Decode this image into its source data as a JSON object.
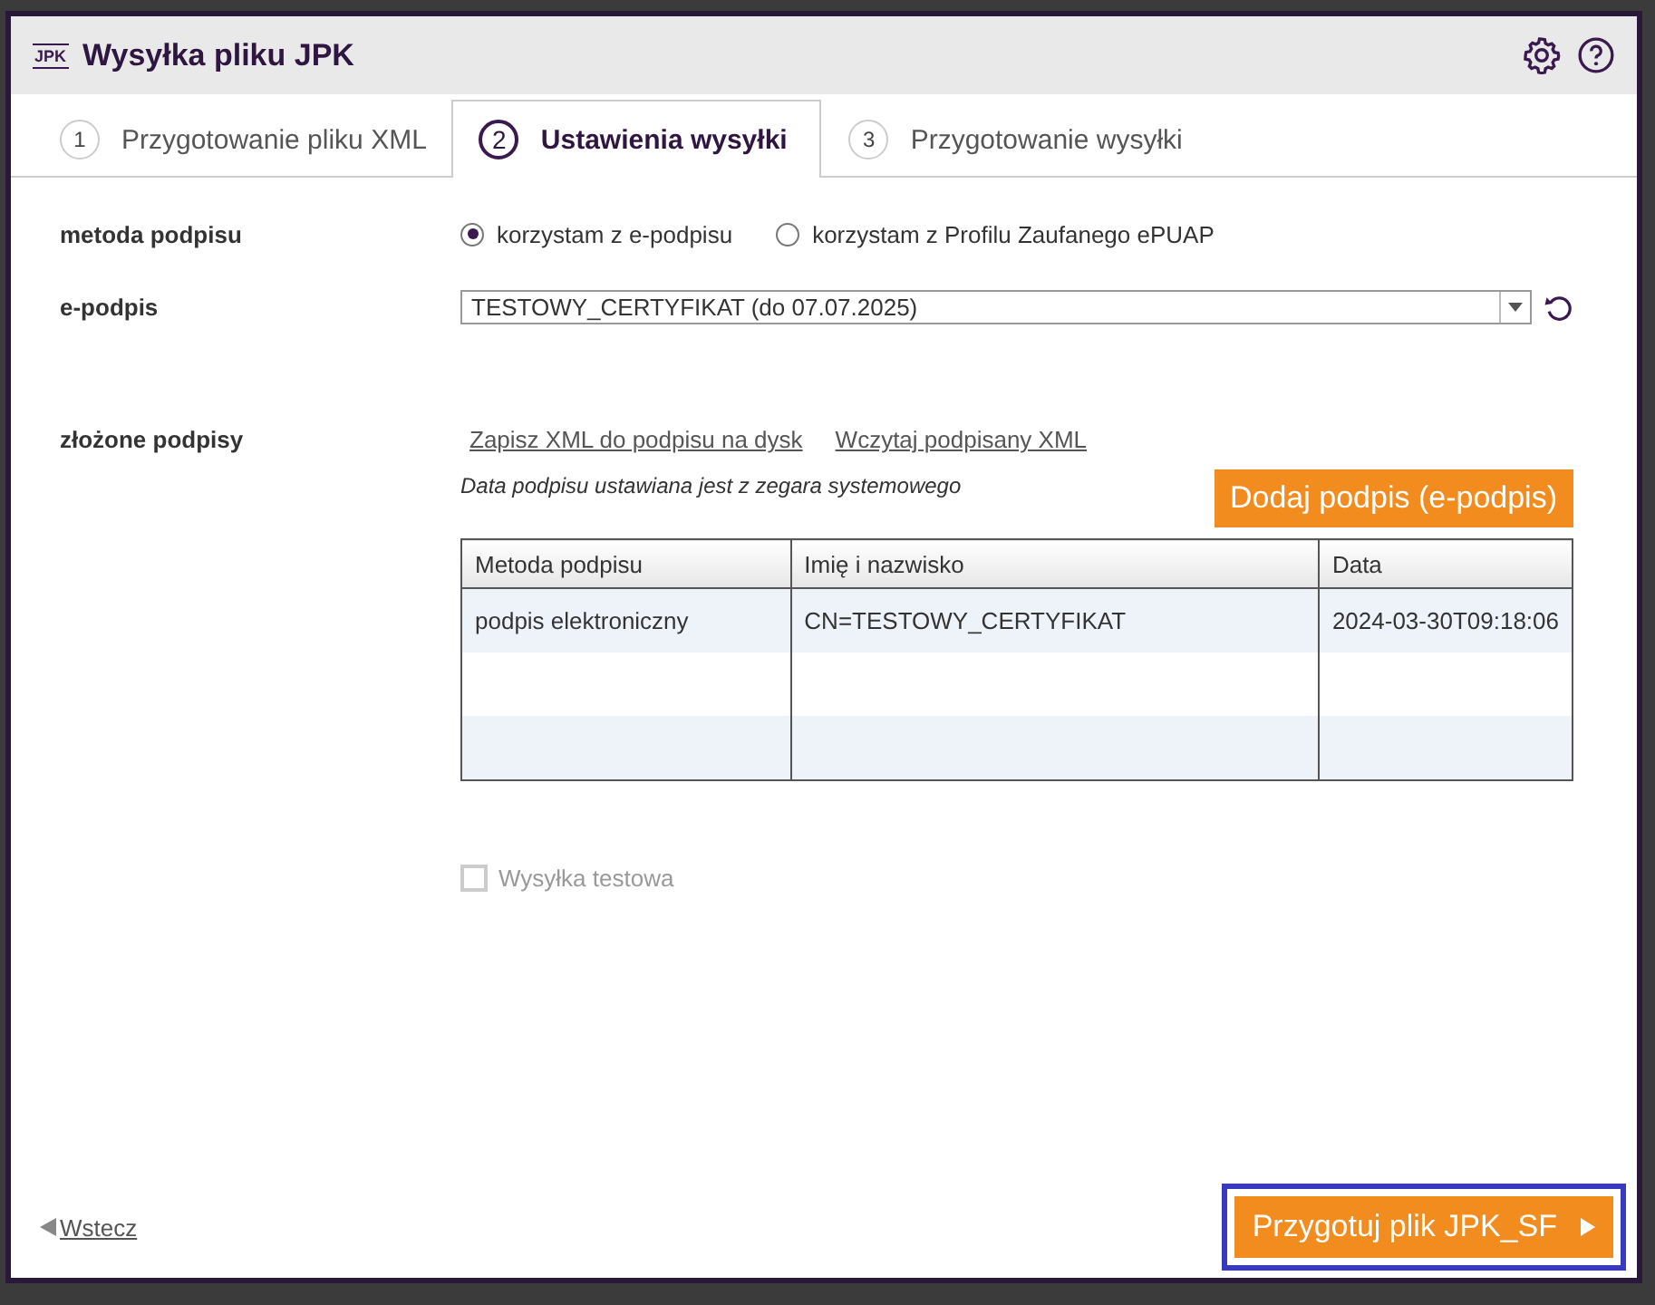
{
  "window": {
    "logo": "JPK",
    "title": "Wysyłka pliku JPK"
  },
  "tabs": [
    {
      "number": "1",
      "label": "Przygotowanie pliku XML",
      "selected": false
    },
    {
      "number": "2",
      "label": "Ustawienia wysyłki",
      "selected": true
    },
    {
      "number": "3",
      "label": "Przygotowanie wysyłki",
      "selected": false
    }
  ],
  "signature_method": {
    "label": "metoda podpisu",
    "options": [
      {
        "label": "korzystam z e-podpisu",
        "selected": true
      },
      {
        "label": "korzystam z Profilu Zaufanego ePUAP",
        "selected": false
      }
    ]
  },
  "e_signature": {
    "label": "e-podpis",
    "value": "TESTOWY_CERTYFIKAT (do 07.07.2025)"
  },
  "signatures": {
    "label": "złożone podpisy",
    "links": [
      "Zapisz XML do podpisu na dysk",
      "Wczytaj podpisany XML"
    ],
    "note": "Data podpisu ustawiana jest z zegara systemowego",
    "add_button": "Dodaj podpis (e-podpis)",
    "table": {
      "columns": [
        "Metoda podpisu",
        "Imię i nazwisko",
        "Data"
      ],
      "rows": [
        [
          "podpis elektroniczny",
          "CN=TESTOWY_CERTYFIKAT",
          "2024-03-30T09:18:06"
        ],
        [
          "",
          "",
          ""
        ],
        [
          "",
          "",
          ""
        ]
      ]
    }
  },
  "test_send": {
    "label": "Wysyłka testowa",
    "checked": false,
    "disabled": true
  },
  "footer": {
    "back": "Wstecz",
    "next": "Przygotuj plik JPK_SF",
    "next_focused": true
  }
}
